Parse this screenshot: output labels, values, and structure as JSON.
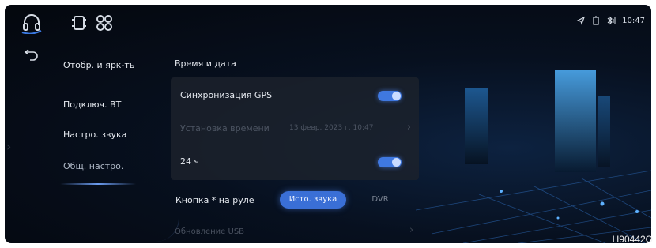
{
  "status": {
    "time": "10:47"
  },
  "icons": [
    "headset-icon",
    "device-settings-icon",
    "fan-icon",
    "navigation-icon",
    "battery-icon",
    "bluetooth-signal-icon",
    "back-arrow-icon"
  ],
  "sidebar": {
    "items": [
      "Отобр. и ярк-ть",
      "Подключ. BT",
      "Настро. звука",
      "Общ. настро."
    ],
    "active_index": 3
  },
  "main": {
    "section_title": "Время и дата",
    "rows": [
      {
        "label": "Синхронизация GPS",
        "toggle": true
      },
      {
        "label": "Установка времени",
        "value": "13 февр. 2023 г. 10:47",
        "disabled": true
      },
      {
        "label": "24 ч",
        "toggle": true
      }
    ],
    "steering": {
      "label": "Кнопка * на руле",
      "options": [
        "Исто. звука",
        "DVR"
      ],
      "selected": "Исто. звука"
    },
    "usb_row": "Обновление USB"
  },
  "colors": {
    "accent": "#3f78e0",
    "background": "#04070d",
    "panel": "#1c222c"
  },
  "figure_code": "H90442O"
}
